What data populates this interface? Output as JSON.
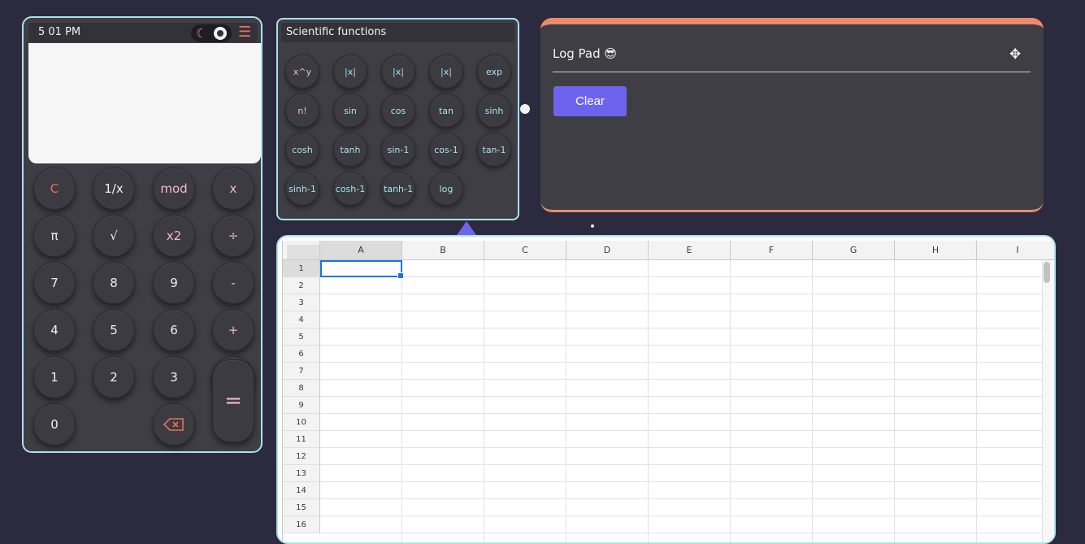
{
  "calculator": {
    "time": "5  01 PM",
    "theme_toggle": "dark",
    "keys": [
      {
        "label": "C",
        "style": "red"
      },
      {
        "label": "1/x",
        "style": "normal"
      },
      {
        "label": "mod",
        "style": "op"
      },
      {
        "label": "x",
        "style": "op"
      },
      {
        "label": "π",
        "style": "normal"
      },
      {
        "label": "√",
        "style": "normal"
      },
      {
        "label": "x2",
        "style": "op"
      },
      {
        "label": "÷",
        "style": "op"
      },
      {
        "label": "7",
        "style": "normal"
      },
      {
        "label": "8",
        "style": "normal"
      },
      {
        "label": "9",
        "style": "normal"
      },
      {
        "label": "-",
        "style": "op"
      },
      {
        "label": "4",
        "style": "normal"
      },
      {
        "label": "5",
        "style": "normal"
      },
      {
        "label": "6",
        "style": "normal"
      },
      {
        "label": "+",
        "style": "op"
      },
      {
        "label": "1",
        "style": "normal"
      },
      {
        "label": "2",
        "style": "normal"
      },
      {
        "label": "3",
        "style": "normal"
      },
      {
        "label": ".",
        "style": "normal"
      },
      {
        "label": "0",
        "style": "normal"
      }
    ],
    "equals_label": "="
  },
  "scientific": {
    "title": "Scientific functions",
    "functions": [
      {
        "label": "x^y",
        "style": "op"
      },
      {
        "label": "|x|",
        "style": "normal"
      },
      {
        "label": "|x|",
        "style": "normal"
      },
      {
        "label": "|x|",
        "style": "normal"
      },
      {
        "label": "exp",
        "style": "normal"
      },
      {
        "label": "n!",
        "style": "op"
      },
      {
        "label": "sin",
        "style": "normal"
      },
      {
        "label": "cos",
        "style": "normal"
      },
      {
        "label": "tan",
        "style": "normal"
      },
      {
        "label": "sinh",
        "style": "normal"
      },
      {
        "label": "cosh",
        "style": "normal"
      },
      {
        "label": "tanh",
        "style": "normal"
      },
      {
        "label": "sin-1",
        "style": "normal"
      },
      {
        "label": "cos-1",
        "style": "normal"
      },
      {
        "label": "tan-1",
        "style": "normal"
      },
      {
        "label": "sinh-1",
        "style": "normal"
      },
      {
        "label": "cosh-1",
        "style": "normal"
      },
      {
        "label": "tanh-1",
        "style": "normal"
      },
      {
        "label": "log",
        "style": "normal"
      }
    ]
  },
  "logpad": {
    "title": "Log Pad 😎",
    "clear_label": "Clear"
  },
  "spreadsheet": {
    "columns": [
      "A",
      "B",
      "C",
      "D",
      "E",
      "F",
      "G",
      "H",
      "I"
    ],
    "rows": [
      "1",
      "2",
      "3",
      "4",
      "5",
      "6",
      "7",
      "8",
      "9",
      "10",
      "11",
      "12",
      "13",
      "14",
      "15",
      "16"
    ],
    "selected_cell": "A1"
  },
  "colors": {
    "background": "#2b2a3e",
    "panel": "#3f3e45",
    "border": "#a9e2ec",
    "accent": "#ec8a6e",
    "button": "#6c64ee"
  }
}
